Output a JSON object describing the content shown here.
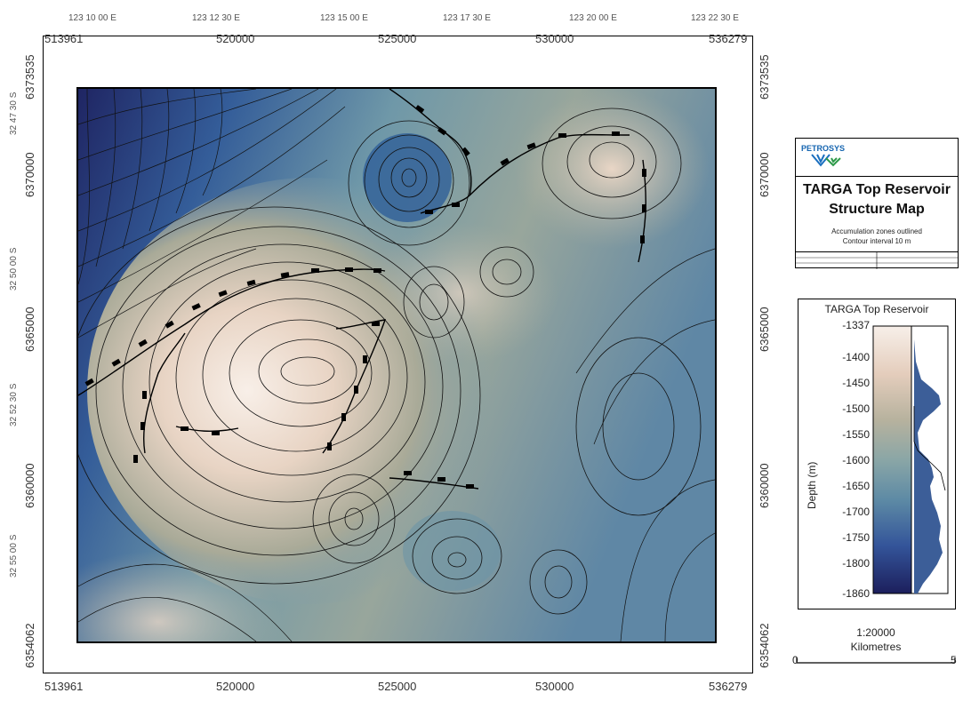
{
  "map": {
    "x_ticks": [
      "513961",
      "520000",
      "525000",
      "530000",
      "536279"
    ],
    "y_ticks": [
      "6373535",
      "6370000",
      "6365000",
      "6360000",
      "6354062"
    ],
    "lon_ticks": [
      "123 10 00 E",
      "123 12 30 E",
      "123 15 00 E",
      "123 17 30 E",
      "123 20 00 E",
      "123 22 30 E"
    ],
    "lat_ticks": [
      "32 47 30 S",
      "32 50 00 S",
      "32 52 30 S",
      "32 55 00 S"
    ]
  },
  "title_block": {
    "logo_text": "PETROSYS",
    "title_line1": "TARGA Top Reservoir",
    "title_line2": "Structure Map",
    "subtitle_line1": "Accumulation zones outlined",
    "subtitle_line2": "Contour interval 10 m"
  },
  "legend": {
    "title": "TARGA Top Reservoir",
    "axis_label": "Depth (m)",
    "ticks": [
      "-1337",
      "-1400",
      "-1450",
      "-1500",
      "-1550",
      "-1600",
      "-1650",
      "-1700",
      "-1750",
      "-1800",
      "-1860"
    ]
  },
  "scale": {
    "ratio": "1:20000",
    "unit": "Kilometres",
    "min": "0",
    "max": "5"
  },
  "colors": {
    "deep": "#1e2260",
    "mid": "#6f9aa8",
    "shallow": "#f6ede6"
  }
}
